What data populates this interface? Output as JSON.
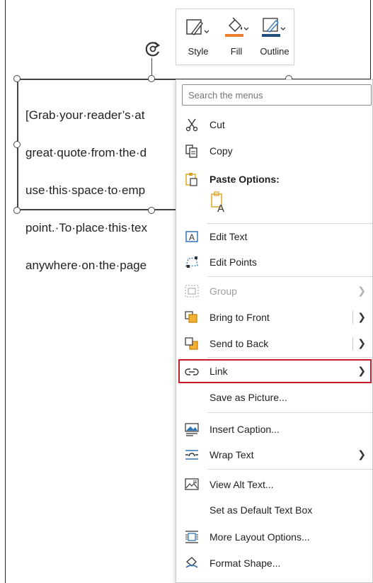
{
  "mini_toolbar": {
    "style_label": "Style",
    "fill_label": "Fill",
    "outline_label": "Outline",
    "fill_color": "#ED7D31",
    "outline_color": "#1F4E79"
  },
  "text_box": {
    "lines": [
      "[Grab·your·reader’s·at",
      "great·quote·from·the·d",
      "use·this·space·to·emp",
      "point.·To·place·this·tex",
      "anywhere·on·the·page"
    ]
  },
  "context_menu": {
    "search_placeholder": "Search the menus",
    "items": {
      "cut": "Cut",
      "copy": "Copy",
      "paste_options": "Paste Options:",
      "edit_text": "Edit Text",
      "edit_points": "Edit Points",
      "group": "Group",
      "bring_to_front": "Bring to Front",
      "send_to_back": "Send to Back",
      "link": "Link",
      "save_as_picture": "Save as Picture...",
      "insert_caption": "Insert Caption...",
      "wrap_text": "Wrap Text",
      "view_alt_text": "View Alt Text...",
      "set_default_text_box": "Set as Default Text Box",
      "more_layout_options": "More Layout Options...",
      "format_shape": "Format Shape..."
    },
    "highlight_color": "#C0202A"
  }
}
